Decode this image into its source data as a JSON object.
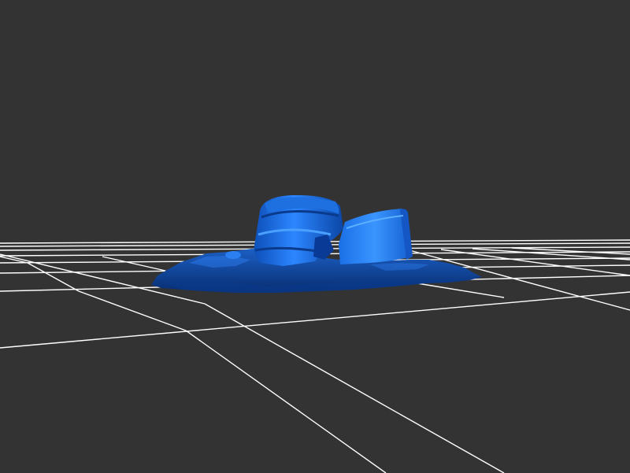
{
  "viewport": {
    "background_color": "#333333",
    "grid_color": "#ffffff",
    "model_color": "#1565d8",
    "model_highlight_color": "#2e86ff",
    "model_shadow_color": "#0a3a8c"
  },
  "scene": {
    "objects": [
      "terrain-mesh",
      "barrel-upright",
      "barrel-tilted"
    ]
  }
}
